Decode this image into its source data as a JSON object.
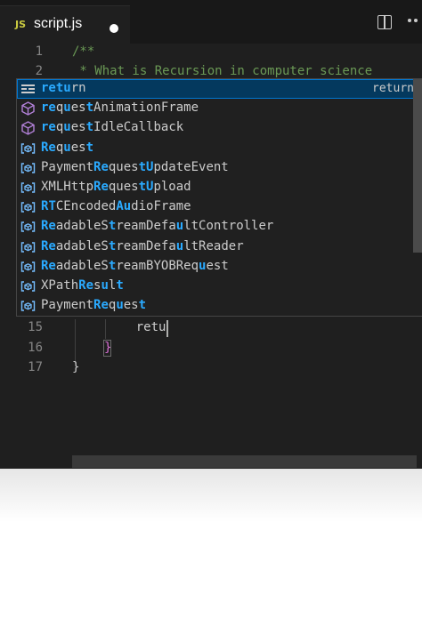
{
  "tab": {
    "file_type_icon": "JS",
    "filename": "script.js",
    "dirty": true
  },
  "toolbar": {
    "icons": [
      "split-editor-icon",
      "more-actions-icon"
    ]
  },
  "editor": {
    "lines": [
      {
        "number": "1",
        "text": "/**",
        "kind": "comment"
      },
      {
        "number": "2",
        "text": " * What is Recursion in computer science",
        "kind": "comment"
      },
      {
        "number": "15",
        "text": "    retu",
        "kind": "plain"
      },
      {
        "number": "16",
        "text": "}",
        "kind": "brace"
      },
      {
        "number": "17",
        "text": "}",
        "kind": "plain"
      }
    ]
  },
  "suggest": {
    "items": [
      {
        "icon": "keyword-icon",
        "parts": [
          {
            "t": "retu",
            "m": true
          },
          {
            "t": "rn",
            "m": false
          }
        ],
        "detail": "return",
        "selected": true
      },
      {
        "icon": "method-icon",
        "parts": [
          {
            "t": "re",
            "m": true
          },
          {
            "t": "q",
            "m": false
          },
          {
            "t": "u",
            "m": true
          },
          {
            "t": "es",
            "m": false
          },
          {
            "t": "t",
            "m": true
          },
          {
            "t": "AnimationFrame",
            "m": false
          }
        ]
      },
      {
        "icon": "method-icon",
        "parts": [
          {
            "t": "re",
            "m": true
          },
          {
            "t": "q",
            "m": false
          },
          {
            "t": "u",
            "m": true
          },
          {
            "t": "es",
            "m": false
          },
          {
            "t": "t",
            "m": true
          },
          {
            "t": "IdleCallback",
            "m": false
          }
        ]
      },
      {
        "icon": "variable-icon",
        "parts": [
          {
            "t": "Re",
            "m": true
          },
          {
            "t": "q",
            "m": false
          },
          {
            "t": "u",
            "m": true
          },
          {
            "t": "es",
            "m": false
          },
          {
            "t": "t",
            "m": true
          }
        ]
      },
      {
        "icon": "variable-icon",
        "parts": [
          {
            "t": "Payment",
            "m": false
          },
          {
            "t": "Re",
            "m": true
          },
          {
            "t": "ques",
            "m": false
          },
          {
            "t": "tU",
            "m": true
          },
          {
            "t": "pdateEvent",
            "m": false
          }
        ]
      },
      {
        "icon": "variable-icon",
        "parts": [
          {
            "t": "XMLHttp",
            "m": false
          },
          {
            "t": "Re",
            "m": true
          },
          {
            "t": "ques",
            "m": false
          },
          {
            "t": "tU",
            "m": true
          },
          {
            "t": "pload",
            "m": false
          }
        ]
      },
      {
        "icon": "variable-icon",
        "parts": [
          {
            "t": "R",
            "m": true
          },
          {
            "t": "T",
            "m": true
          },
          {
            "t": "CEncoded",
            "m": false
          },
          {
            "t": "Au",
            "m": true
          },
          {
            "t": "dioFrame",
            "m": false
          }
        ]
      },
      {
        "icon": "variable-icon",
        "parts": [
          {
            "t": "Re",
            "m": true
          },
          {
            "t": "adableS",
            "m": false
          },
          {
            "t": "t",
            "m": true
          },
          {
            "t": "reamDefa",
            "m": false
          },
          {
            "t": "u",
            "m": true
          },
          {
            "t": "ltController",
            "m": false
          }
        ]
      },
      {
        "icon": "variable-icon",
        "parts": [
          {
            "t": "Re",
            "m": true
          },
          {
            "t": "adableS",
            "m": false
          },
          {
            "t": "t",
            "m": true
          },
          {
            "t": "reamDefa",
            "m": false
          },
          {
            "t": "u",
            "m": true
          },
          {
            "t": "ltReader",
            "m": false
          }
        ]
      },
      {
        "icon": "variable-icon",
        "parts": [
          {
            "t": "Re",
            "m": true
          },
          {
            "t": "adableS",
            "m": false
          },
          {
            "t": "t",
            "m": true
          },
          {
            "t": "reamBYOBReq",
            "m": false
          },
          {
            "t": "u",
            "m": true
          },
          {
            "t": "est",
            "m": false
          }
        ]
      },
      {
        "icon": "variable-icon",
        "parts": [
          {
            "t": "XPath",
            "m": false
          },
          {
            "t": "Re",
            "m": true
          },
          {
            "t": "s",
            "m": false
          },
          {
            "t": "u",
            "m": true
          },
          {
            "t": "l",
            "m": false
          },
          {
            "t": "t",
            "m": true
          }
        ]
      },
      {
        "icon": "variable-icon",
        "parts": [
          {
            "t": "Payment",
            "m": false
          },
          {
            "t": "Re",
            "m": true
          },
          {
            "t": "q",
            "m": false
          },
          {
            "t": "u",
            "m": true
          },
          {
            "t": "es",
            "m": false
          },
          {
            "t": "t",
            "m": true
          }
        ]
      }
    ]
  },
  "colors": {
    "editor_bg": "#1f1f1f",
    "match_highlight": "#2aaaff",
    "selection_bg": "#04395e",
    "comment": "#6a9955",
    "method_icon": "#b180d7",
    "variable_icon": "#75beff"
  }
}
